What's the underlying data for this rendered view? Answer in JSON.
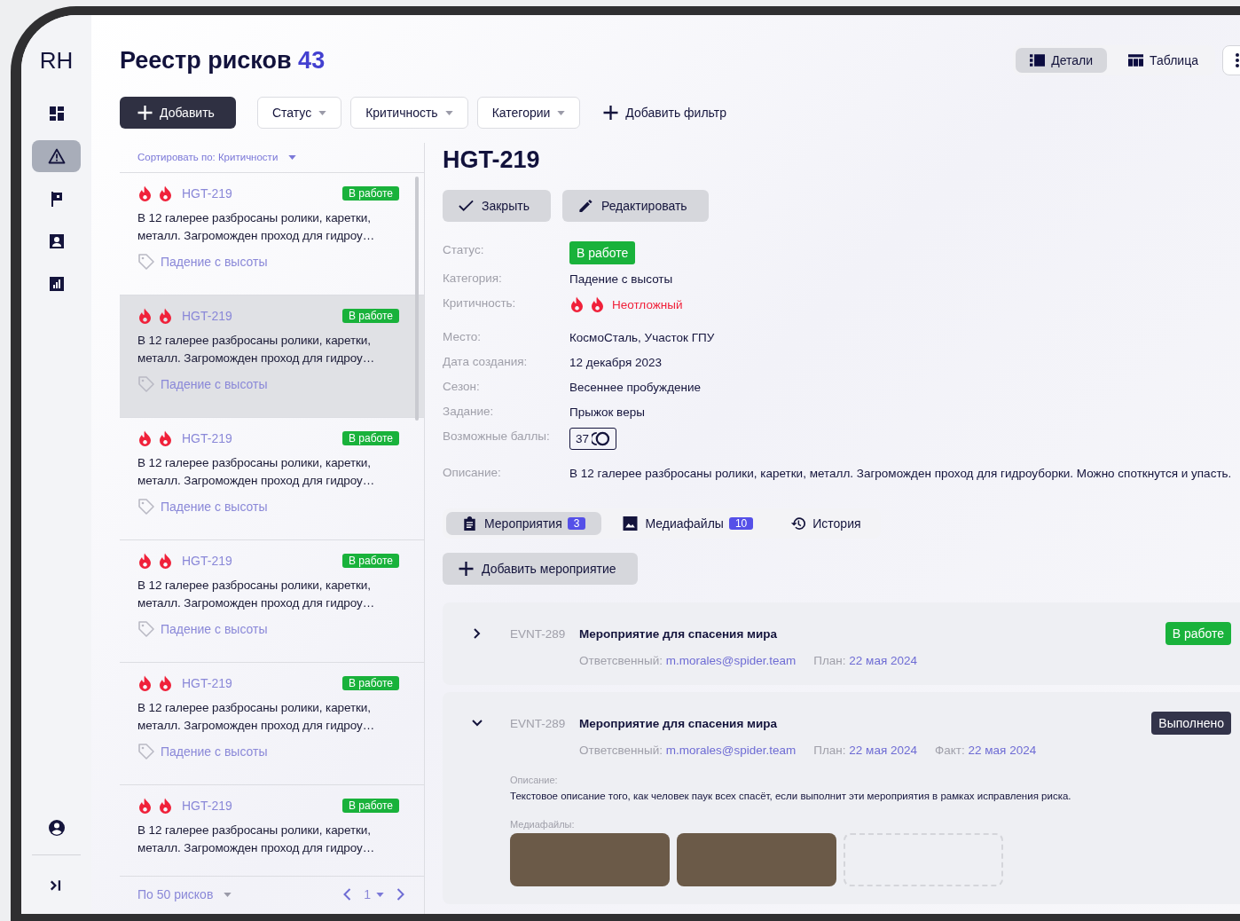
{
  "sidebar": {
    "logo": "RH",
    "items": [
      {
        "selected": false
      },
      {
        "selected": true
      },
      {
        "selected": false
      },
      {
        "selected": false
      },
      {
        "selected": false
      }
    ]
  },
  "header": {
    "title": "Реестр рисков",
    "count": "43",
    "view_toggle": [
      {
        "label": "Детали",
        "selected": true
      },
      {
        "label": "Таблица",
        "selected": false
      }
    ]
  },
  "toolbar": {
    "add_button": "Добавить",
    "filters": [
      "Статус",
      "Критичность",
      "Категории"
    ],
    "add_filter": "Добавить фильтр"
  },
  "list": {
    "sort": "Сортировать по: Критичности",
    "items": [
      {
        "id": "HGT-219",
        "status": {
          "label": "В работе",
          "kind": "in_progress"
        },
        "description": "В 12 галерее разбросаны ролики, каретки, металл. Загроможден проход для гидроу…",
        "category": "Падение с высоты",
        "selected": false
      },
      {
        "id": "HGT-219",
        "status": {
          "label": "В работе",
          "kind": "in_progress"
        },
        "description": "В 12 галерее разбросаны ролики, каретки, металл. Загроможден проход для гидроу…",
        "category": "Падение с высоты",
        "selected": true
      },
      {
        "id": "HGT-219",
        "status": {
          "label": "В работе",
          "kind": "in_progress"
        },
        "description": "В 12 галерее разбросаны ролики, каретки, металл. Загроможден проход для гидроу…",
        "category": "Падение с высоты",
        "selected": false
      },
      {
        "id": "HGT-219",
        "status": {
          "label": "В работе",
          "kind": "in_progress"
        },
        "description": "В 12 галерее разбросаны ролики, каретки, металл. Загроможден проход для гидроу…",
        "category": "Падение с высоты",
        "selected": false
      },
      {
        "id": "HGT-219",
        "status": {
          "label": "В работе",
          "kind": "in_progress"
        },
        "description": "В 12 галерее разбросаны ролики, каретки, металл. Загроможден проход для гидроу…",
        "category": "Падение с высоты",
        "selected": false
      },
      {
        "id": "HGT-219",
        "status": {
          "label": "В работе",
          "kind": "in_progress"
        },
        "description": "В 12 галерее разбросаны ролики, каретки, металл. Загроможден проход для гидроу…",
        "selected": false
      }
    ],
    "footer": {
      "page_size": "По 50 рисков",
      "page": "1"
    }
  },
  "detail": {
    "title": "HGT-219",
    "actions": [
      "Закрыть",
      "Редактировать"
    ],
    "field_groups": [
      {
        "fields": [
          {
            "label": "Статус:",
            "kind": "badge",
            "value": {
              "label": "В работе",
              "kind": "in_progress"
            }
          },
          {
            "label": "Категория:",
            "kind": "text",
            "value": "Падение с высоты"
          },
          {
            "label": "Критичность:",
            "kind": "criticality",
            "value": "Неотложный"
          }
        ]
      },
      {
        "fields": [
          {
            "label": "Место:",
            "kind": "text",
            "value": "КосмоСталь, Участок ГПУ"
          },
          {
            "label": "Дата создания:",
            "kind": "text",
            "value": "12 декабря 2023"
          },
          {
            "label": "Сезон:",
            "kind": "text",
            "value": "Весеннее пробуждение"
          },
          {
            "label": "Задание:",
            "kind": "text",
            "value": "Прыжок веры"
          },
          {
            "label": "Возможные баллы:",
            "kind": "points",
            "value": "37"
          }
        ]
      },
      {
        "fields": [
          {
            "label": "Описание:",
            "kind": "text",
            "value": "В 12 галерее разбросаны ролики, каретки, металл. Загроможден проход для гидроуборки. Можно споткнутся и упасть."
          }
        ]
      }
    ],
    "tabs": [
      {
        "label": "Мероприятия",
        "count": "3",
        "selected": true
      },
      {
        "label": "Медиафайлы",
        "count": "10",
        "selected": false
      },
      {
        "label": "История",
        "selected": false
      }
    ],
    "add_event": "Добавить мероприятие",
    "events": [
      {
        "id": "EVNT-289",
        "title": "Мероприятие для спасения мира",
        "status": {
          "label": "В работе",
          "kind": "in_progress"
        },
        "expanded": false,
        "meta": [
          {
            "label": "Ответсвенный:",
            "value": "m.morales@spider.team"
          },
          {
            "label": "План:",
            "value": "22 мая 2024"
          }
        ]
      },
      {
        "id": "EVNT-289",
        "title": "Мероприятие для спасения мира",
        "status": {
          "label": "Выполнено",
          "kind": "done"
        },
        "expanded": true,
        "meta": [
          {
            "label": "Ответсвенный:",
            "value": "m.morales@spider.team"
          },
          {
            "label": "План:",
            "value": "22 мая 2024"
          },
          {
            "label": "Факт:",
            "value": "22 мая 2024"
          }
        ],
        "description_label": "Описание:",
        "description": "Текстовое описание того, как человек паук всех спасёт, если выполнит эти мероприятия в рамках исправления риска.",
        "media_label": "Медиафайлы:",
        "media": [
          {
            "kind": "photo"
          },
          {
            "kind": "photo"
          },
          {
            "kind": "add_slot"
          }
        ]
      }
    ]
  }
}
